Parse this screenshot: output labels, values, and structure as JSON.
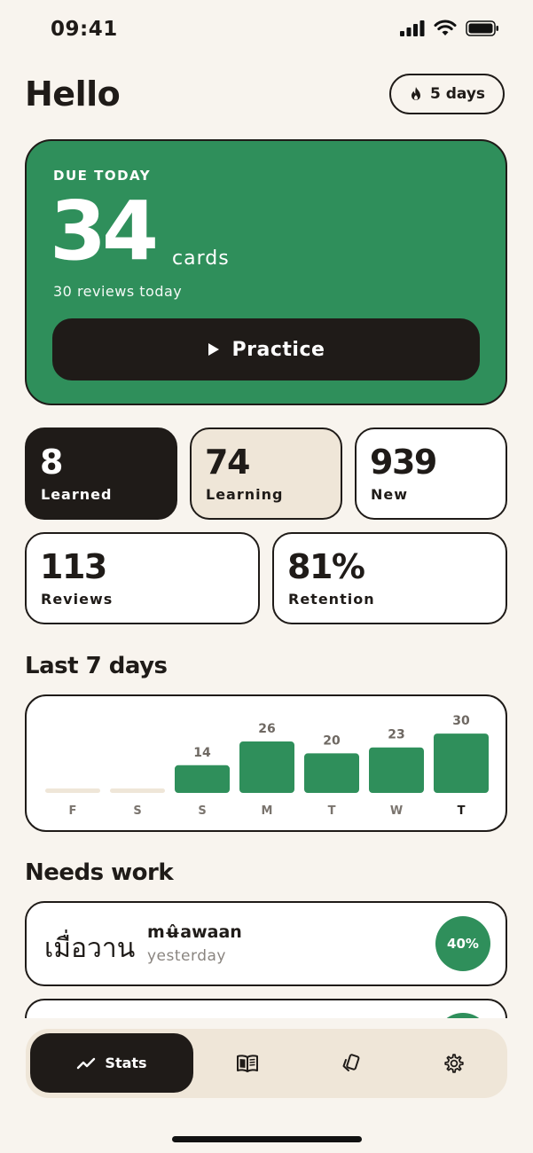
{
  "status_bar": {
    "time": "09:41"
  },
  "header": {
    "greeting": "Hello",
    "streak": "5 days"
  },
  "due": {
    "label": "DUE TODAY",
    "count": "34",
    "unit": "cards",
    "reviews_today": "30 reviews today",
    "practice_label": "Practice"
  },
  "stats": {
    "learned": {
      "value": "8",
      "label": "Learned"
    },
    "learning": {
      "value": "74",
      "label": "Learning"
    },
    "new": {
      "value": "939",
      "label": "New"
    },
    "reviews": {
      "value": "113",
      "label": "Reviews"
    },
    "retention": {
      "value": "81%",
      "label": "Retention"
    }
  },
  "last7": {
    "title": "Last 7 days"
  },
  "chart_data": {
    "type": "bar",
    "categories": [
      "F",
      "S",
      "S",
      "M",
      "T",
      "W",
      "T"
    ],
    "values": [
      0,
      0,
      14,
      26,
      20,
      23,
      30
    ],
    "data_labels": [
      "",
      "",
      "14",
      "26",
      "20",
      "23",
      "30"
    ],
    "highlight_index": 6,
    "colors": {
      "bar": "#2f8f5b",
      "empty": "#efe6d8"
    }
  },
  "needs_work": {
    "title": "Needs work",
    "items": [
      {
        "thai": "เมื่อวาน",
        "roman": "mʉ̂awaan",
        "meaning": "yesterday",
        "percent": "40%"
      }
    ]
  },
  "tab_bar": {
    "stats_label": "Stats",
    "icons": [
      "trend-icon",
      "book-icon",
      "cards-icon",
      "gear-icon"
    ]
  },
  "colors": {
    "accent": "#2f8f5b",
    "dark": "#1f1b18",
    "background": "#f8f4ee",
    "cream": "#efe6d8"
  }
}
